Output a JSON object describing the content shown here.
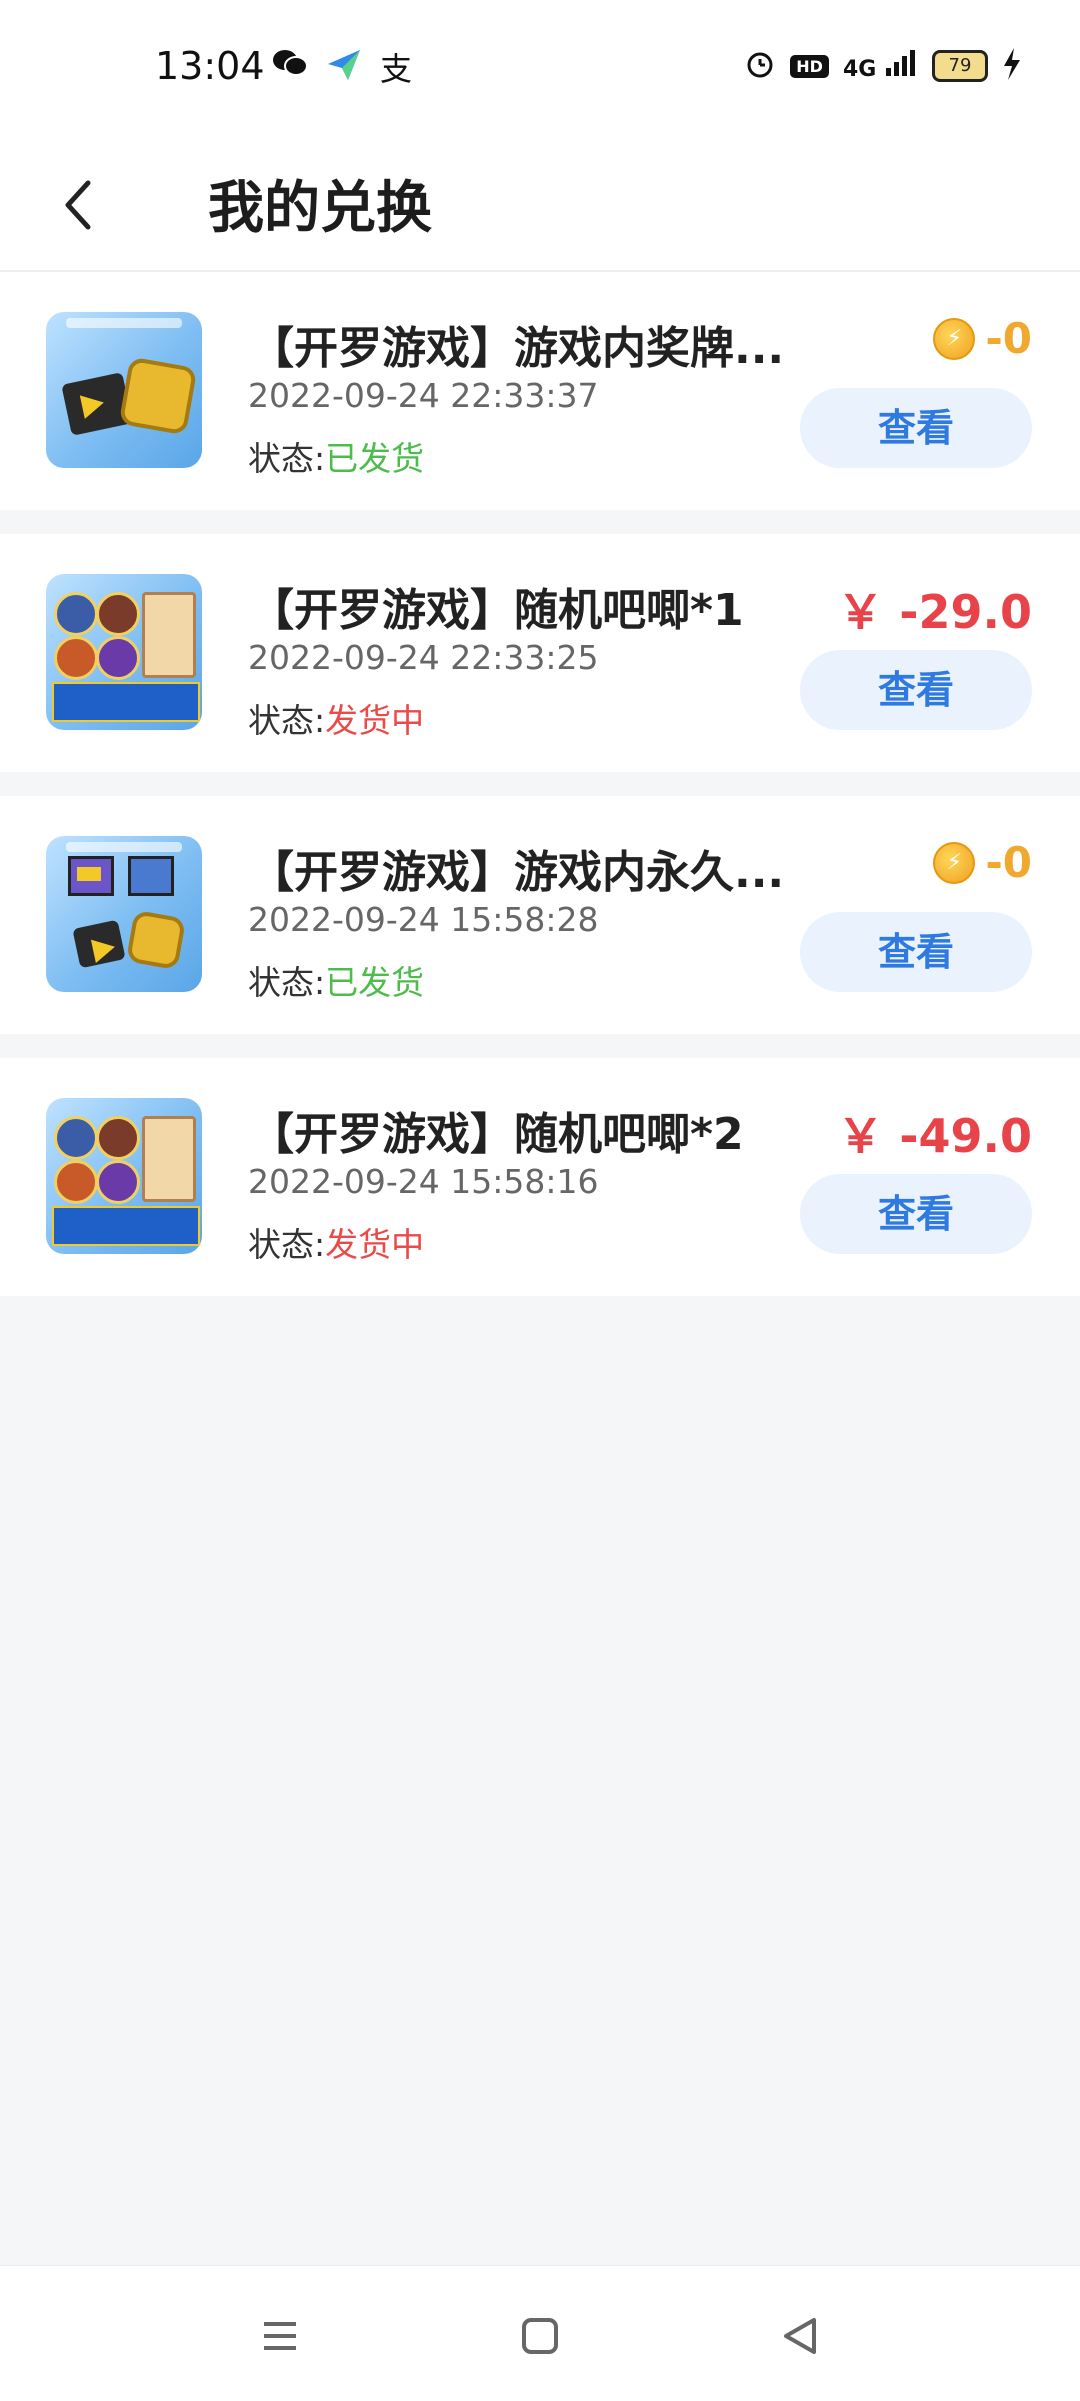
{
  "status_bar": {
    "time": "13:04",
    "apps": [
      "wechat-icon",
      "paper-plane-icon",
      "alipay-icon"
    ],
    "alipay_glyph": "支",
    "hd": "HD",
    "signal": "4G",
    "battery": "79"
  },
  "header": {
    "title": "我的兑换"
  },
  "colors": {
    "status_done": "#4cbc4a",
    "status_going": "#ea4a48",
    "coin_price": "#f0a92e",
    "cash_price": "#e9434a",
    "button_text": "#2f7ae0",
    "button_bg": "#eaf2fe"
  },
  "status_label": "状态:",
  "view_label": "查看",
  "items": [
    {
      "title": "【开罗游戏】游戏内奖牌...",
      "time": "2022-09-24  22:33:37",
      "status": "已发货",
      "price_type": "coin",
      "price": "-0"
    },
    {
      "title": "【开罗游戏】随机吧唧*1",
      "time": "2022-09-24  22:33:25",
      "status": "发货中",
      "price_type": "cash",
      "price": "￥ -29.0"
    },
    {
      "title": "【开罗游戏】游戏内永久...",
      "time": "2022-09-24  15:58:28",
      "status": "已发货",
      "price_type": "coin",
      "price": "-0"
    },
    {
      "title": "【开罗游戏】随机吧唧*2",
      "time": "2022-09-24  15:58:16",
      "status": "发货中",
      "price_type": "cash",
      "price": "￥ -49.0"
    }
  ],
  "navbar": {
    "buttons": [
      "menu-icon",
      "home-icon",
      "back-triangle-icon"
    ]
  }
}
